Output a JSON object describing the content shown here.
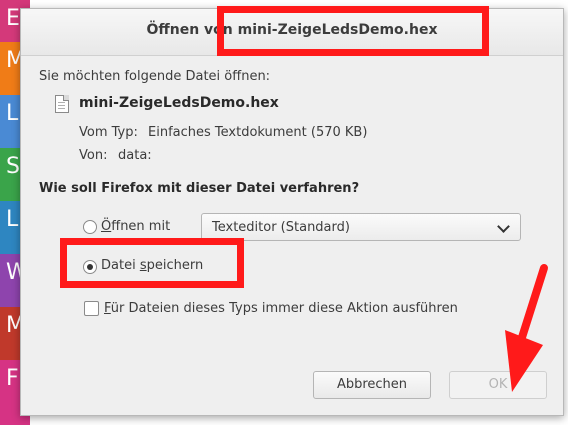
{
  "background_app": {
    "tile_letters": [
      "E",
      "M",
      "L",
      "S",
      "L",
      "W",
      "M",
      "F"
    ],
    "tile_colors": [
      "#d4397a",
      "#f07c17",
      "#4a8ad4",
      "#3aa44a",
      "#2e86c1",
      "#8e44ad",
      "#c0392b",
      "#d63384"
    ]
  },
  "dialog": {
    "title": "Öffnen von mini-ZeigeLedsDemo.hex",
    "intro": "Sie möchten folgende Datei öffnen:",
    "file_name": "mini-ZeigeLedsDemo.hex",
    "file_icon": "text-file-icon",
    "type_label": "Vom Typ:",
    "type_value": "Einfaches Textdokument (570 KB)",
    "from_label": "Von:",
    "from_value": "data:",
    "question": "Wie soll Firefox mit dieser Datei verfahren?",
    "open_with_prefix": "Ö",
    "open_with_rest": "ffnen mit",
    "open_with_app": "Texteditor (Standard)",
    "save_prefix": "Datei ",
    "save_underlined": "s",
    "save_rest": "peichern",
    "remember_prefix": "F",
    "remember_rest": "ür Dateien dieses Typs immer diese Aktion ausführen",
    "cancel_label": "Abbrechen",
    "ok_label": "OK",
    "selected_option": "save",
    "remember_checked": false,
    "ok_enabled": false
  },
  "annotations": {
    "highlight_color": "#ff1a1a"
  }
}
